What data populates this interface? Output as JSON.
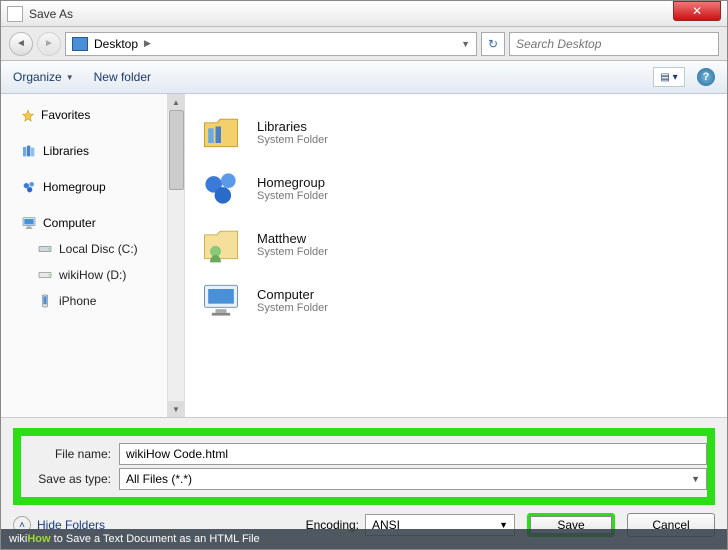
{
  "window": {
    "title": "Save As"
  },
  "addr": {
    "path_label": "Desktop",
    "search_placeholder": "Search Desktop"
  },
  "toolbar": {
    "organize": "Organize",
    "newfolder": "New folder"
  },
  "sidebar": {
    "favorites": "Favorites",
    "libraries": "Libraries",
    "homegroup": "Homegroup",
    "computer": "Computer",
    "drives": [
      "Local Disc (C:)",
      "wikiHow (D:)",
      "iPhone"
    ]
  },
  "main": {
    "items": [
      {
        "name": "Libraries",
        "sub": "System Folder"
      },
      {
        "name": "Homegroup",
        "sub": "System Folder"
      },
      {
        "name": "Matthew",
        "sub": "System Folder"
      },
      {
        "name": "Computer",
        "sub": "System Folder"
      }
    ]
  },
  "form": {
    "filename_label": "File name:",
    "filename_value": "wikiHow Code.html",
    "type_label": "Save as type:",
    "type_value": "All Files  (*.*)",
    "encoding_label": "Encoding:",
    "encoding_value": "ANSI",
    "hide_folders": "Hide Folders",
    "save": "Save",
    "cancel": "Cancel"
  },
  "watermark": {
    "brand": "wiki",
    "brand2": "How",
    "text": " to Save a Text Document as an HTML File"
  }
}
